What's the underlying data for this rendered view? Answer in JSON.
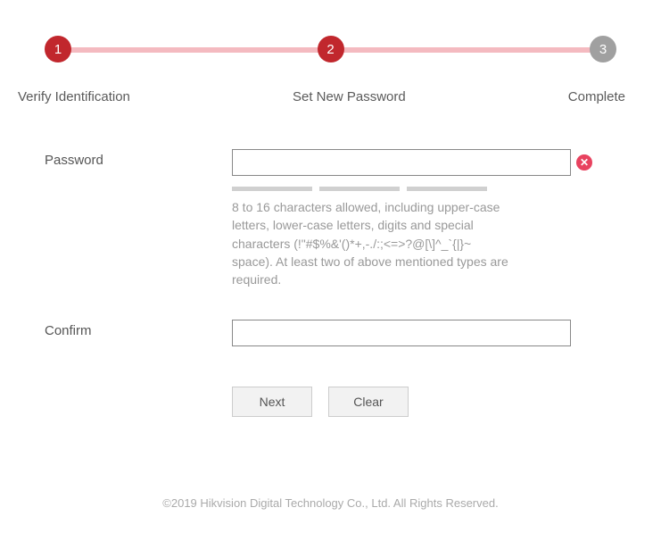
{
  "steps": {
    "items": [
      {
        "num": "1",
        "label": "Verify Identification"
      },
      {
        "num": "2",
        "label": "Set New Password"
      },
      {
        "num": "3",
        "label": "Complete"
      }
    ]
  },
  "form": {
    "password_label": "Password",
    "password_value": "",
    "hint": "8 to 16 characters allowed, including upper-case letters, lower-case letters, digits and special characters (!\"#$%&'()*+,-./:;<=>?@[\\]^_`{|}~ space). At least two of above mentioned types are required.",
    "confirm_label": "Confirm",
    "confirm_value": ""
  },
  "buttons": {
    "next": "Next",
    "clear": "Clear"
  },
  "footer": "©2019 Hikvision Digital Technology Co., Ltd. All Rights Reserved."
}
